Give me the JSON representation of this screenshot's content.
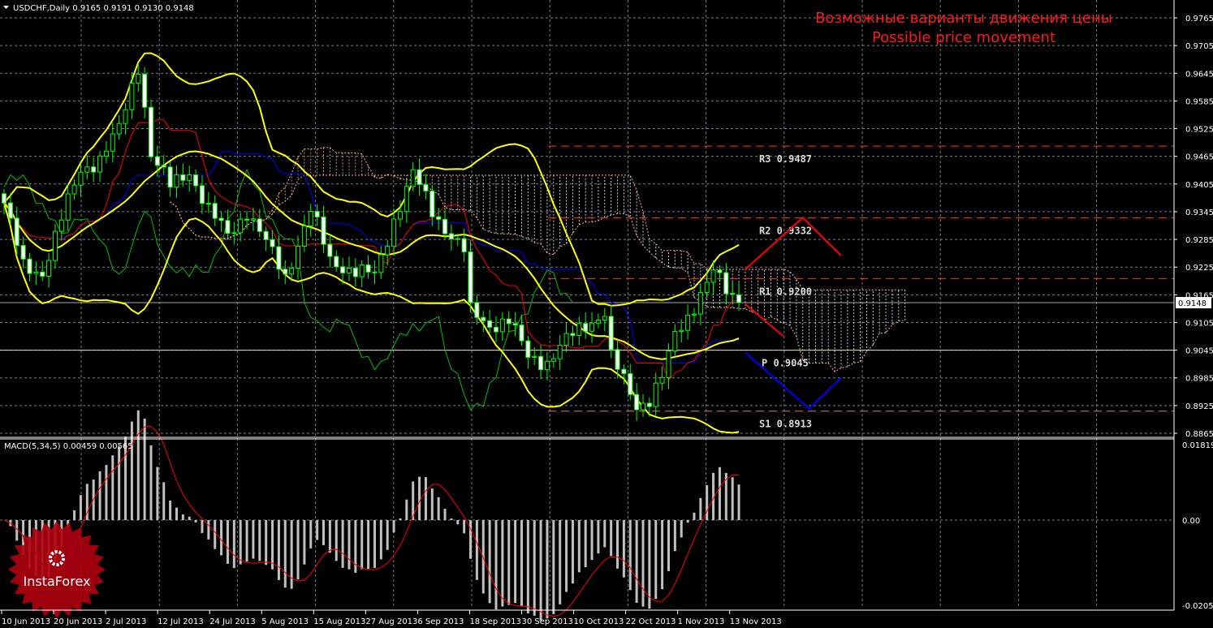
{
  "chart_data": {
    "type": "candlestick",
    "symbol_header": "USDCHF,Daily  0.9165 0.9191 0.9130 0.9148",
    "symbol": "USDCHF",
    "timeframe": "Daily",
    "ohlc_last": {
      "open": 0.9165,
      "high": 0.9191,
      "low": 0.913,
      "close": 0.9148
    },
    "title_ru": "Возможные варианты движения цены",
    "title_en": "Possible price movement",
    "current_price": "0.9148",
    "ylim": [
      0.8865,
      0.9765
    ],
    "y_ticks": [
      "0.9765",
      "0.9705",
      "0.9645",
      "0.9585",
      "0.9525",
      "0.9465",
      "0.9405",
      "0.9345",
      "0.9285",
      "0.9225",
      "0.9165",
      "0.9105",
      "0.9045",
      "0.8985",
      "0.8925",
      "0.8865"
    ],
    "x_ticks": [
      "10 Jun 2013",
      "20 Jun 2013",
      "2 Jul 2013",
      "12 Jul 2013",
      "24 Jul 2013",
      "5 Aug 2013",
      "15 Aug 2013",
      "27 Aug 2013",
      "6 Sep 2013",
      "18 Sep 2013",
      "30 Sep 2013",
      "10 Oct 2013",
      "22 Oct 2013",
      "1 Nov 2013",
      "13 Nov 2013"
    ],
    "close_keypoints": [
      [
        0,
        0.9364
      ],
      [
        3,
        0.9224
      ],
      [
        6,
        0.9215
      ],
      [
        9,
        0.9329
      ],
      [
        12,
        0.9435
      ],
      [
        15,
        0.9461
      ],
      [
        18,
        0.9522
      ],
      [
        21,
        0.9663
      ],
      [
        22,
        0.9575
      ],
      [
        23,
        0.947
      ],
      [
        26,
        0.9399
      ],
      [
        29,
        0.9435
      ],
      [
        32,
        0.9347
      ],
      [
        35,
        0.9294
      ],
      [
        38,
        0.9347
      ],
      [
        41,
        0.9276
      ],
      [
        44,
        0.9206
      ],
      [
        48,
        0.9347
      ],
      [
        51,
        0.9241
      ],
      [
        55,
        0.9215
      ],
      [
        58,
        0.9206
      ],
      [
        61,
        0.9329
      ],
      [
        64,
        0.9426
      ],
      [
        67,
        0.9347
      ],
      [
        70,
        0.9294
      ],
      [
        72,
        0.9259
      ],
      [
        73,
        0.9127
      ],
      [
        76,
        0.9101
      ],
      [
        79,
        0.9109
      ],
      [
        82,
        0.903
      ],
      [
        85,
        0.9021
      ],
      [
        88,
        0.9065
      ],
      [
        91,
        0.9101
      ],
      [
        94,
        0.9127
      ],
      [
        95,
        0.903
      ],
      [
        97,
        0.8977
      ],
      [
        99,
        0.8925
      ],
      [
        101,
        0.8942
      ],
      [
        103,
        0.8986
      ],
      [
        105,
        0.9074
      ],
      [
        107,
        0.9118
      ],
      [
        109,
        0.9171
      ],
      [
        111,
        0.9215
      ],
      [
        113,
        0.9171
      ],
      [
        115,
        0.9148
      ]
    ],
    "indicators": [
      "Bollinger Bands",
      "Ichimoku Kinko Hyo"
    ],
    "pivots": [
      {
        "name": "R3",
        "value": 0.9487,
        "label": "R3  0.9487",
        "color": "#ff4000"
      },
      {
        "name": "R2",
        "value": 0.9332,
        "label": "R2  0.9332",
        "color": "#ff4000"
      },
      {
        "name": "R1",
        "value": 0.92,
        "label": "R1  0.9200",
        "color": "#ff4000"
      },
      {
        "name": "P",
        "value": 0.9045,
        "label": "P  0.9045",
        "color": "#ffd000"
      },
      {
        "name": "S1",
        "value": 0.8913,
        "label": "S1  0.8913",
        "color": "#d08080"
      }
    ],
    "scenarios": [
      {
        "color": "#ff0000",
        "points": [
          [
            116,
            0.922
          ],
          [
            125,
            0.9332
          ],
          [
            131,
            0.925
          ]
        ]
      },
      {
        "color": "#ff0000",
        "points": [
          [
            116,
            0.9145
          ],
          [
            122,
            0.9075
          ]
        ]
      },
      {
        "color": "#0000ff",
        "points": [
          [
            116,
            0.904
          ],
          [
            126,
            0.8918
          ],
          [
            131,
            0.8985
          ]
        ]
      }
    ],
    "macd": {
      "label": "MACD(5,34,5) 0.00459 0.00565",
      "params": [
        5,
        34,
        5
      ],
      "ylim": [
        -0.02053,
        0.01819
      ],
      "y_ticks": [
        "0.01819",
        "0.00",
        "-0.02053"
      ]
    },
    "colors": {
      "bull": "#00ff00",
      "bear": "#ffffff",
      "bands": "#ffff00",
      "tenkan": "#ff0000",
      "kijun": "#0000ff",
      "chikou": "#00c000",
      "cloud": "#ffb090",
      "grid": "#6f7f8f"
    }
  },
  "logo": {
    "text": "InstaForex"
  }
}
